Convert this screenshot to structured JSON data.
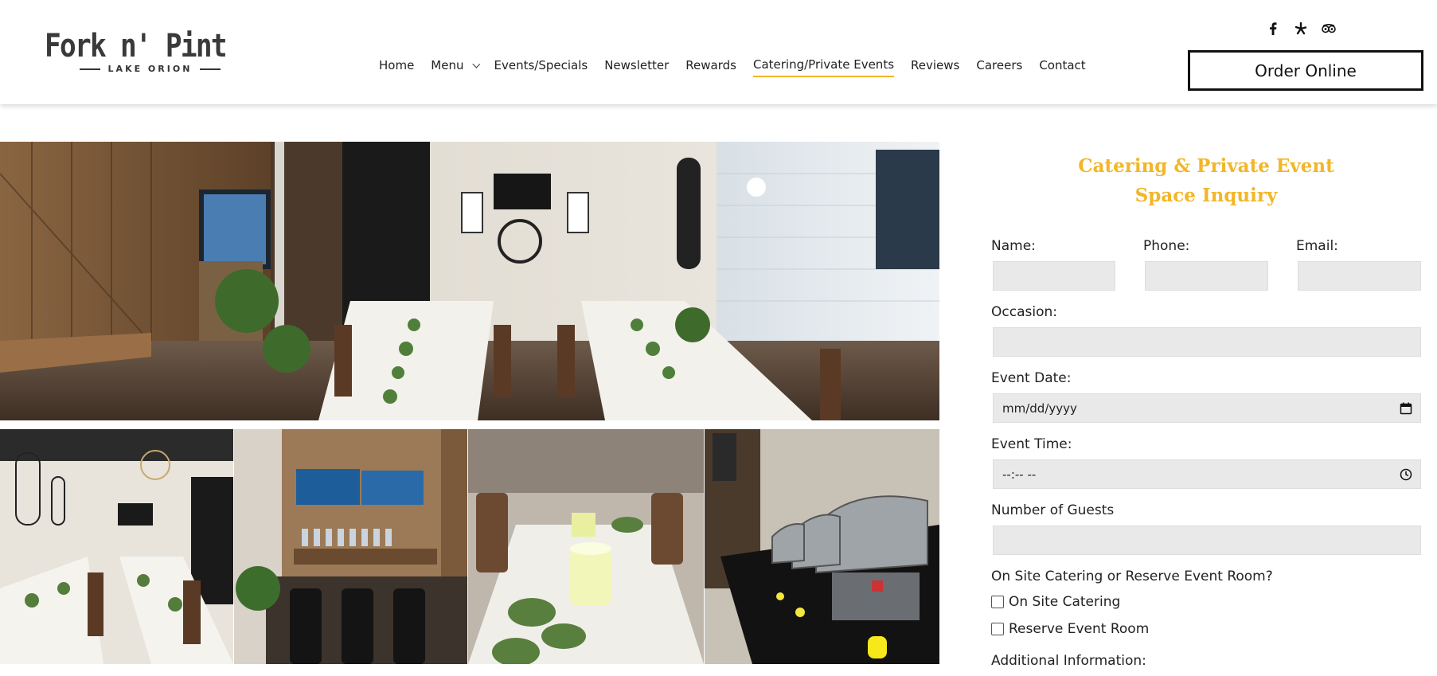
{
  "brand": {
    "name": "Fork n' Pint",
    "location": "LAKE ORION",
    "accent_color": "#f2b628"
  },
  "nav": {
    "items": [
      {
        "label": "Home"
      },
      {
        "label": "Menu",
        "has_dropdown": true
      },
      {
        "label": "Events/Specials"
      },
      {
        "label": "Newsletter"
      },
      {
        "label": "Rewards"
      },
      {
        "label": "Catering/Private Events",
        "active": true
      },
      {
        "label": "Reviews"
      },
      {
        "label": "Careers"
      },
      {
        "label": "Contact"
      }
    ]
  },
  "social": {
    "icons": [
      "facebook-icon",
      "yelp-icon",
      "tripadvisor-icon"
    ]
  },
  "order_button": {
    "label": "Order Online"
  },
  "gallery": {
    "photos": [
      {
        "name": "event-room-wide-photo"
      },
      {
        "name": "event-room-tables-photo"
      },
      {
        "name": "bar-tvs-photo"
      },
      {
        "name": "table-candle-photo"
      },
      {
        "name": "buffet-chafing-dishes-photo"
      }
    ]
  },
  "form": {
    "title_line1": "Catering & Private Event",
    "title_line2": "Space Inquiry",
    "name_label": "Name:",
    "phone_label": "Phone:",
    "email_label": "Email:",
    "occasion_label": "Occasion:",
    "event_date_label": "Event Date:",
    "event_date_placeholder": "mm/dd/yyyy",
    "event_time_label": "Event Time:",
    "event_time_placeholder": "--:-- --",
    "guests_label": "Number of Guests",
    "catering_question": "On Site Catering or Reserve Event Room?",
    "option_catering": "On Site Catering",
    "option_room": "Reserve Event Room",
    "additional_label": "Additional Information:"
  }
}
